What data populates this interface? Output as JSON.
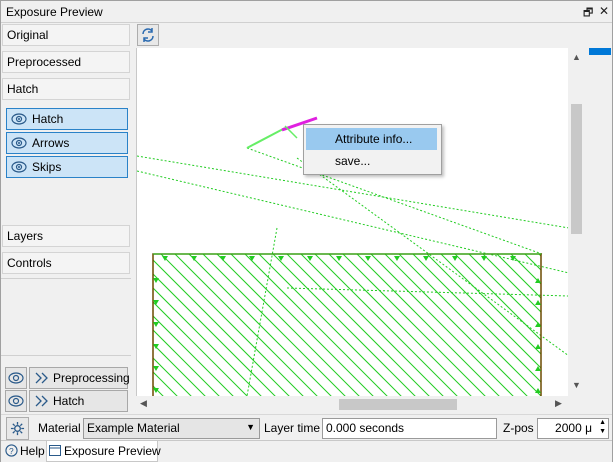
{
  "window": {
    "title": "Exposure Preview"
  },
  "sidebar": {
    "sections": [
      {
        "label": "Original"
      },
      {
        "label": "Preprocessed"
      },
      {
        "label": "Hatch"
      }
    ],
    "toggles": [
      {
        "label": "Hatch"
      },
      {
        "label": "Arrows"
      },
      {
        "label": "Skips"
      }
    ],
    "lower_sections": [
      {
        "label": "Layers"
      },
      {
        "label": "Controls"
      }
    ],
    "pipeline": [
      {
        "label": "Preprocessing"
      },
      {
        "label": "Hatch"
      }
    ]
  },
  "context_menu": {
    "items": [
      {
        "label": "Attribute info..."
      },
      {
        "label": "save..."
      }
    ]
  },
  "bottom_bar": {
    "material_label": "Material",
    "material_value": "Example Material",
    "layer_time_label": "Layer time",
    "layer_time_value": "0.000 seconds",
    "zpos_label": "Z-pos",
    "zpos_value": "2000 μ"
  },
  "tabs": [
    {
      "label": "Help"
    },
    {
      "label": "Exposure Preview"
    }
  ],
  "colors": {
    "hatch": "#22cc22",
    "contour": "#6b4a00",
    "selection": "#e020e0",
    "toggle_active": "#cce4f7",
    "menu_highlight": "#99c9ef"
  }
}
